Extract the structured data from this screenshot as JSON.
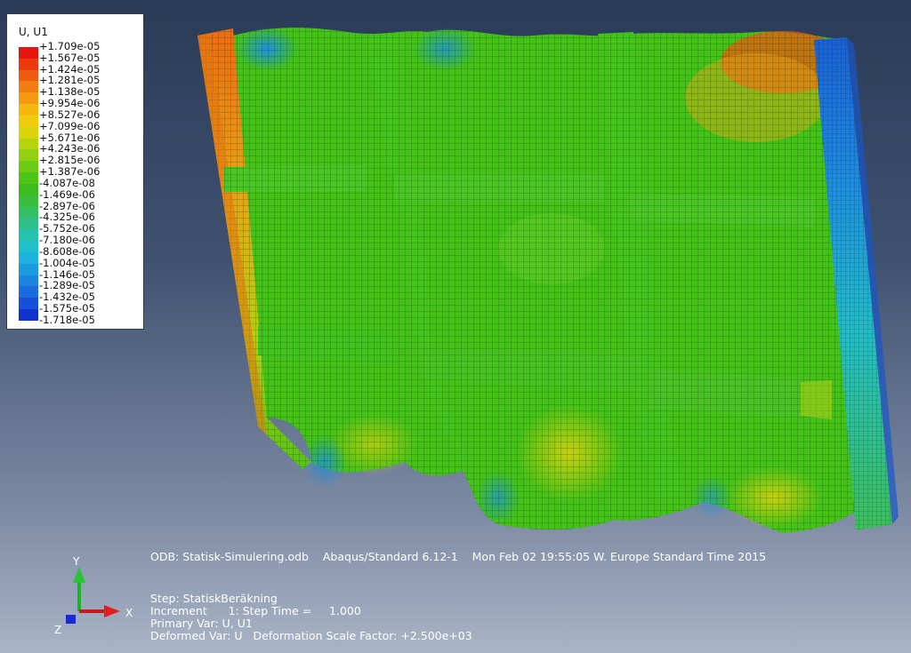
{
  "legend": {
    "title": "U, U1",
    "labels": [
      "+1.709e-05",
      "+1.567e-05",
      "+1.424e-05",
      "+1.281e-05",
      "+1.138e-05",
      "+9.954e-06",
      "+8.527e-06",
      "+7.099e-06",
      "+5.671e-06",
      "+4.243e-06",
      "+2.815e-06",
      "+1.387e-06",
      "-4.087e-08",
      "-1.469e-06",
      "-2.897e-06",
      "-4.325e-06",
      "-5.752e-06",
      "-7.180e-06",
      "-8.608e-06",
      "-1.004e-05",
      "-1.146e-05",
      "-1.289e-05",
      "-1.432e-05",
      "-1.575e-05",
      "-1.718e-05"
    ],
    "colors": [
      "#e8140e",
      "#ec3a0e",
      "#ee5c10",
      "#f07c12",
      "#f39a10",
      "#f4b80e",
      "#efcd0c",
      "#d9d40c",
      "#b6d40e",
      "#92d012",
      "#6ecc14",
      "#4ec418",
      "#3cbc1c",
      "#38bd3c",
      "#34be64",
      "#2ebf8a",
      "#26c2ad",
      "#20bfcb",
      "#1cb2dd",
      "#1a9cdf",
      "#1a84df",
      "#1a6bdf",
      "#1750d8",
      "#1132cc",
      "#0a1bc2"
    ]
  },
  "info": {
    "odb": "ODB: Statisk-Simulering.odb    Abaqus/Standard 6.12-1    Mon Feb 02 19:55:05 W. Europe Standard Time 2015",
    "step": "Step: StatiskBeräkning",
    "increment": "Increment      1: Step Time =     1.000",
    "primary_var": "Primary Var: U, U1",
    "deformed_var": "Deformed Var: U   Deformation Scale Factor: +2.500e+03"
  },
  "triad": {
    "x_label": "X",
    "y_label": "Y",
    "z_label": "Z"
  }
}
